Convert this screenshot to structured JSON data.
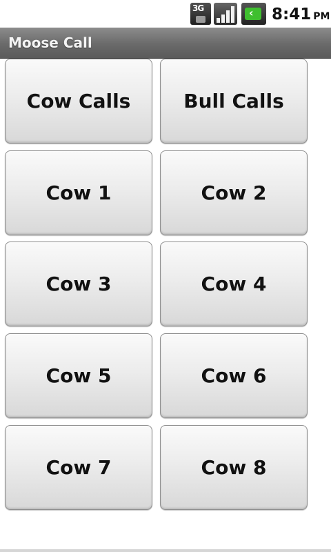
{
  "status_bar": {
    "network_badge": "3G",
    "battery_glyph": "‹",
    "time": "8:41",
    "ampm": "PM",
    "icons": [
      "network-3g-icon",
      "signal-strength-icon",
      "battery-charging-icon"
    ]
  },
  "app": {
    "title": "Moose Call"
  },
  "buttons": [
    {
      "label": "Cow Calls"
    },
    {
      "label": "Bull Calls"
    },
    {
      "label": "Cow 1"
    },
    {
      "label": "Cow 2"
    },
    {
      "label": "Cow 3"
    },
    {
      "label": "Cow 4"
    },
    {
      "label": "Cow 5"
    },
    {
      "label": "Cow 6"
    },
    {
      "label": "Cow 7"
    },
    {
      "label": "Cow 8"
    }
  ],
  "colors": {
    "title_bar": "#6a6a6a",
    "battery_accent": "#3fbf2f",
    "button_text": "#111111"
  }
}
